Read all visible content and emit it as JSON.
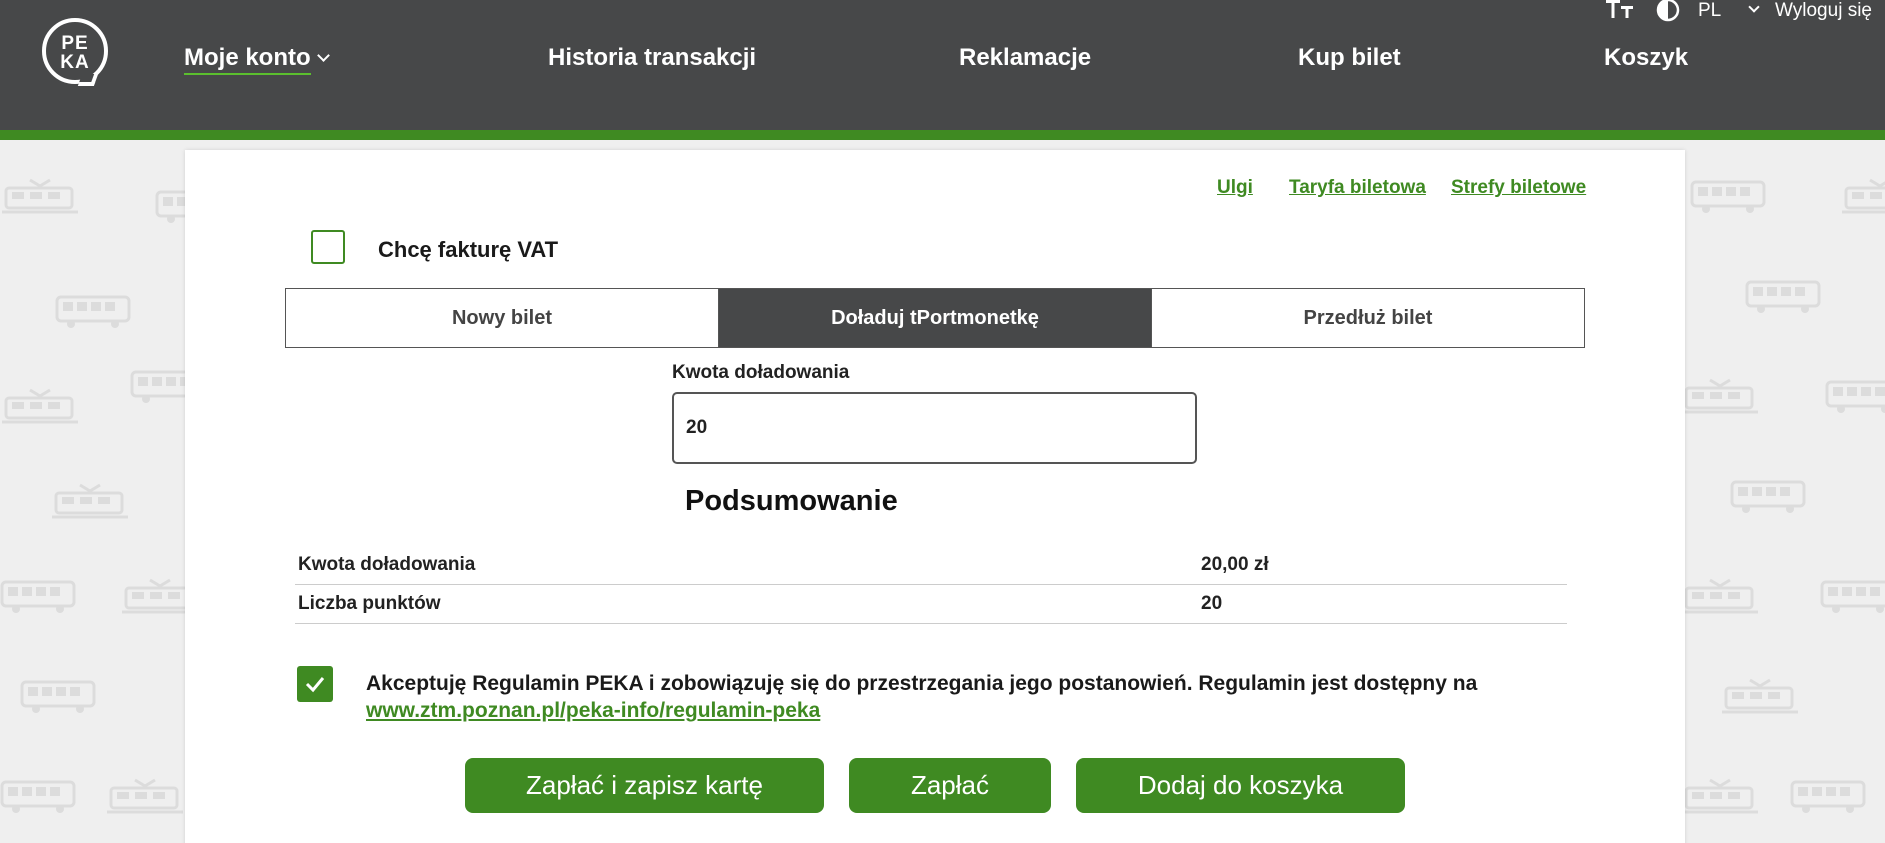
{
  "header": {
    "logo_text_line1": "PE",
    "logo_text_line2": "KA",
    "nav": [
      {
        "label": "Moje konto"
      },
      {
        "label": "Historia transakcji"
      },
      {
        "label": "Reklamacje"
      },
      {
        "label": "Kup bilet"
      },
      {
        "label": "Koszyk"
      }
    ],
    "language": "PL",
    "logout_label": "Wyloguj się"
  },
  "card": {
    "links": [
      "Ulgi",
      "Taryfa biletowa",
      "Strefy biletowe"
    ],
    "vat_label": "Chcę fakturę VAT",
    "vat_checked": false,
    "tabs": [
      {
        "label": "Nowy bilet"
      },
      {
        "label": "Doładuj tPortmonetkę"
      },
      {
        "label": "Przedłuż bilet"
      }
    ],
    "active_tab": "Doładuj tPortmonetkę",
    "amount_label": "Kwota doładowania",
    "amount_value": "20",
    "summary_title": "Podsumowanie",
    "summary_rows": [
      {
        "label": "Kwota doładowania",
        "value": "20,00 zł"
      },
      {
        "label": "Liczba punktów",
        "value": "20"
      }
    ],
    "accept_checked": true,
    "accept_text": "Akceptuję Regulamin PEKA i zobowiązuję się do przestrzegania jego postanowień. Regulamin jest dostępny na",
    "accept_link": "www.ztm.poznan.pl/peka-info/regulamin-peka",
    "buttons": {
      "pay_save": "Zapłać i zapisz kartę",
      "pay": "Zapłać",
      "add_cart": "Dodaj do koszyka"
    }
  },
  "colors": {
    "header_bg": "#474849",
    "accent_green": "#3f8a22",
    "active_tab_bg": "#474849"
  }
}
